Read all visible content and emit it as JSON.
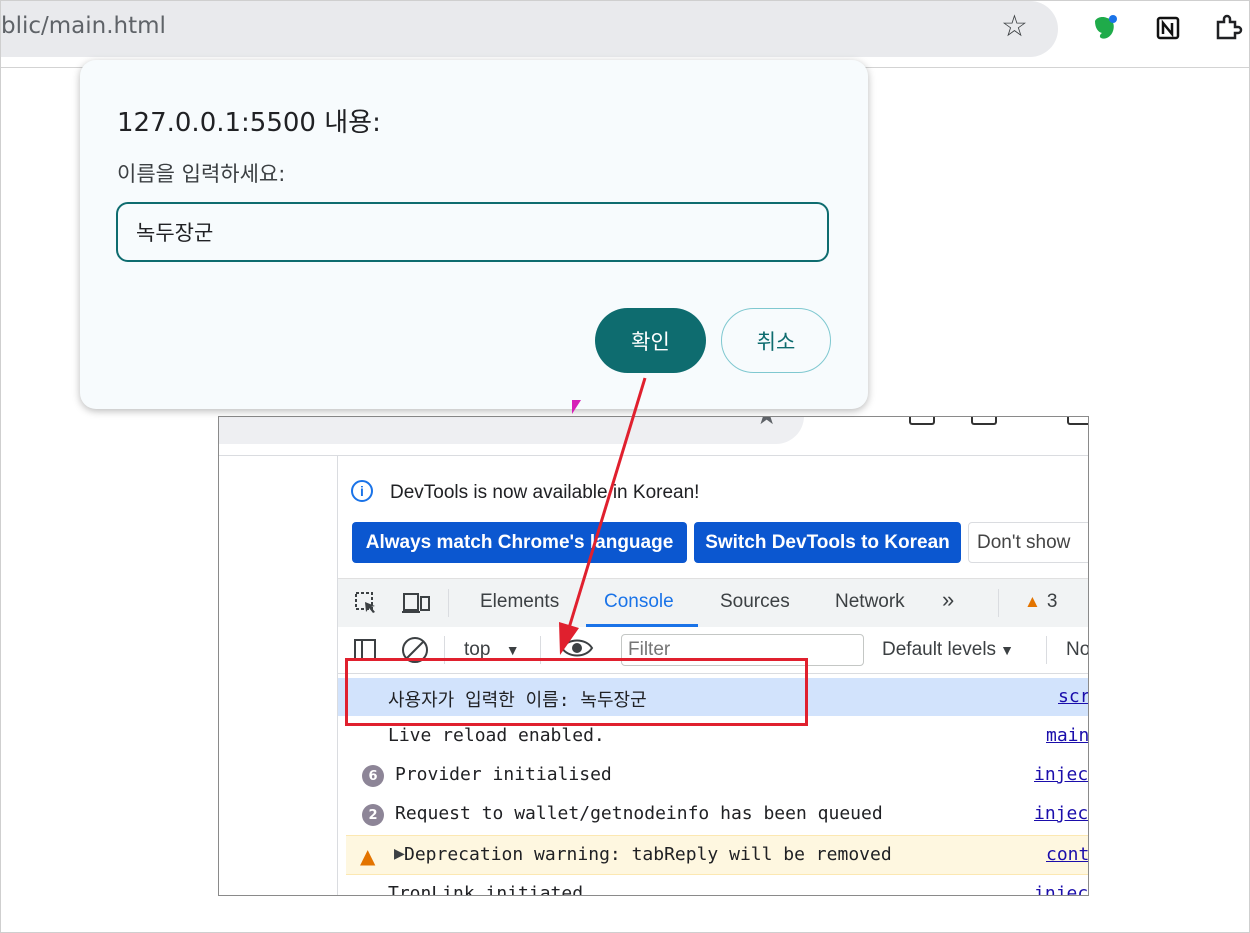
{
  "browser": {
    "url": "blic/main.html",
    "icons": [
      "star-icon",
      "evernote-icon",
      "notion-icon",
      "extensions-icon"
    ]
  },
  "dialog": {
    "title": "127.0.0.1:5500 내용:",
    "message": "이름을 입력하세요:",
    "input_value": "녹두장군",
    "ok_label": "확인",
    "cancel_label": "취소",
    "colors": {
      "accent": "#0e6c6f",
      "background": "#f7fbfd"
    }
  },
  "devtools": {
    "info_text": "DevTools is now available in Korean!",
    "buttons": {
      "match_language": "Always match Chrome's language",
      "switch_korean": "Switch DevTools to Korean",
      "dont_show": "Don't show"
    },
    "tabs": [
      "Elements",
      "Console",
      "Sources",
      "Network"
    ],
    "more_tabs": "»",
    "active_tab": "Console",
    "warning_count": "3",
    "filterbar": {
      "context": "top",
      "filter_placeholder": "Filter",
      "levels": "Default levels",
      "trailing": "No"
    },
    "logs": [
      {
        "message": "사용자가 입력한 이름: 녹두장군",
        "source": "scr",
        "selected": true
      },
      {
        "message": "Live reload enabled.",
        "source": "main"
      },
      {
        "count": "6",
        "message": "Provider initialised",
        "source": "injec"
      },
      {
        "count": "2",
        "message": "Request to wallet/getnodeinfo has been queued",
        "source": "injec"
      },
      {
        "level": "warning",
        "message": "Deprecation warning: tabReply will be removed",
        "source": "cont"
      },
      {
        "message": "TronLink initiated",
        "source": "injec"
      }
    ]
  },
  "annotation_colors": {
    "highlight": "#e0202e"
  }
}
